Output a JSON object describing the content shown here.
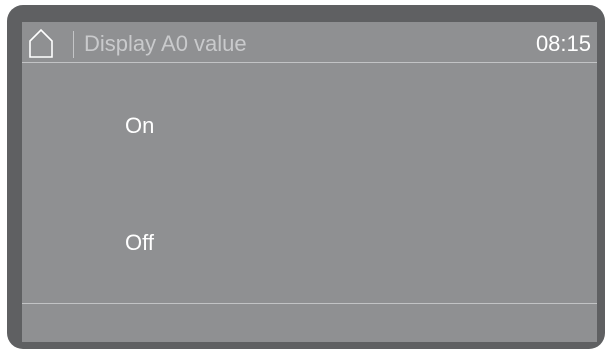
{
  "header": {
    "home_icon": "home-icon",
    "title": "Display A0 value",
    "time": "08:15"
  },
  "options": [
    {
      "label": "On"
    },
    {
      "label": "Off"
    }
  ],
  "colors": {
    "bezel": "#5f6062",
    "screen": "#8f9092",
    "text": "#ffffff",
    "title_text": "#c9cacc",
    "rule": "#c2c3c5"
  }
}
